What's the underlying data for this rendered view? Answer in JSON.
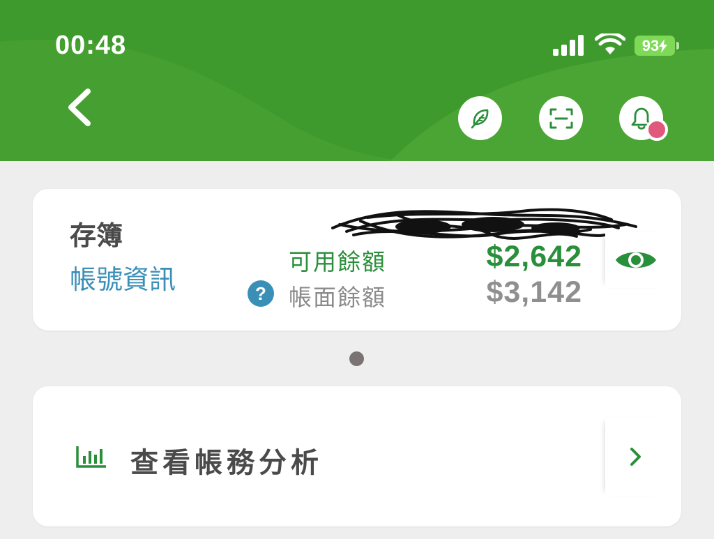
{
  "status_bar": {
    "time": "00:48",
    "battery": "93",
    "icons": [
      "cellular-signal-icon",
      "wifi-icon",
      "battery-charging-icon"
    ]
  },
  "header": {
    "back_icon": "chevron-left-icon",
    "actions": [
      {
        "name": "leaf-icon"
      },
      {
        "name": "scan-icon"
      },
      {
        "name": "bell-icon",
        "has_notification": true
      }
    ],
    "colors": {
      "background": "#3f9a2e",
      "notification": "#e0587b"
    }
  },
  "account": {
    "type_label": "存簿",
    "info_link": "帳號資訊",
    "available_label": "可用餘額",
    "available_value": "$2,642",
    "book_label": "帳面餘額",
    "book_value": "$3,142",
    "help_glyph": "?",
    "toggle_icon": "eye-icon",
    "colors": {
      "available": "#2a8f3a",
      "link": "#3a8fb7",
      "muted": "#8f8f8f"
    }
  },
  "pager": {
    "active_index": 0,
    "count": 1
  },
  "analysis": {
    "label": "查看帳務分析",
    "icon": "bar-chart-icon",
    "chevron_icon": "chevron-right-icon"
  }
}
